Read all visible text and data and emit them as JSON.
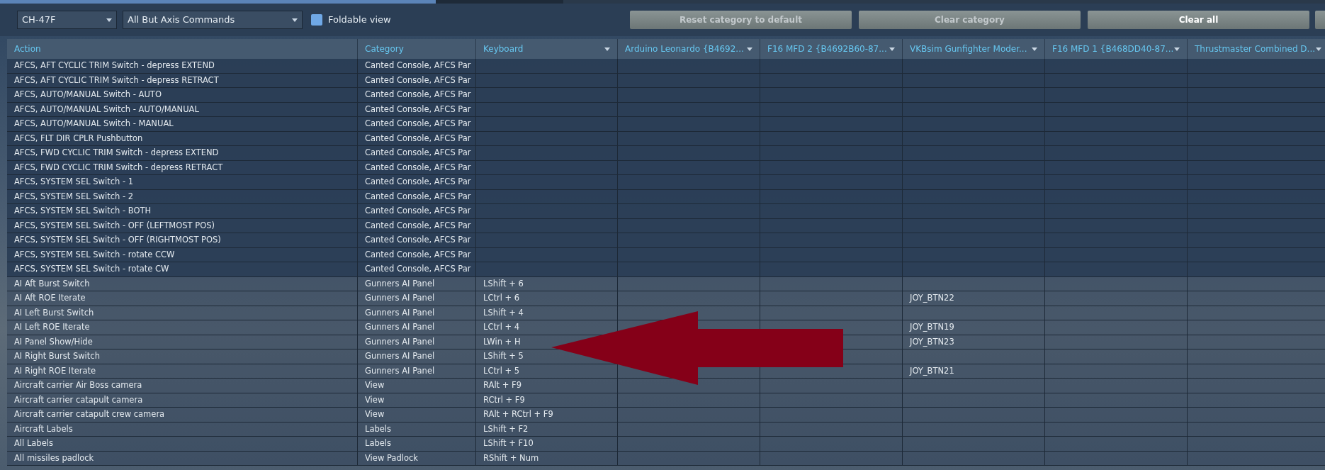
{
  "toolbar": {
    "aircraft_select": {
      "value": "CH-47F"
    },
    "filter_select": {
      "value": "All But Axis Commands"
    },
    "foldable_view": {
      "label": "Foldable view",
      "checked": true
    },
    "buttons": [
      {
        "label": "Reset category to default",
        "disabled": true
      },
      {
        "label": "Clear category",
        "disabled": true
      },
      {
        "label": "Clear all",
        "disabled": false
      }
    ]
  },
  "table": {
    "columns": [
      {
        "label": "Action",
        "dropdown": false
      },
      {
        "label": "Category",
        "dropdown": false
      },
      {
        "label": "Keyboard",
        "dropdown": true
      },
      {
        "label": "Arduino Leonardo {B4692...",
        "dropdown": true
      },
      {
        "label": "F16 MFD 2 {B4692B60-87...",
        "dropdown": true
      },
      {
        "label": "VKBsim Gunfighter Moder...",
        "dropdown": true
      },
      {
        "label": "F16 MFD 1 {B468DD40-87...",
        "dropdown": true
      },
      {
        "label": "Thrustmaster Combined D...",
        "dropdown": true
      }
    ],
    "rows": [
      {
        "action": "AFCS, AFT CYCLIC TRIM Switch - depress EXTEND",
        "category": "Canted Console, AFCS Par"
      },
      {
        "action": "AFCS, AFT CYCLIC TRIM Switch - depress RETRACT",
        "category": "Canted Console, AFCS Par"
      },
      {
        "action": "AFCS, AUTO/MANUAL Switch - AUTO",
        "category": "Canted Console, AFCS Par"
      },
      {
        "action": "AFCS, AUTO/MANUAL Switch - AUTO/MANUAL",
        "category": "Canted Console, AFCS Par"
      },
      {
        "action": "AFCS, AUTO/MANUAL Switch - MANUAL",
        "category": "Canted Console, AFCS Par"
      },
      {
        "action": "AFCS, FLT DIR CPLR Pushbutton",
        "category": "Canted Console, AFCS Par"
      },
      {
        "action": "AFCS, FWD CYCLIC TRIM Switch - depress EXTEND",
        "category": "Canted Console, AFCS Par"
      },
      {
        "action": "AFCS, FWD CYCLIC TRIM Switch - depress RETRACT",
        "category": "Canted Console, AFCS Par"
      },
      {
        "action": "AFCS, SYSTEM SEL Switch - 1",
        "category": "Canted Console, AFCS Par"
      },
      {
        "action": "AFCS, SYSTEM SEL Switch - 2",
        "category": "Canted Console, AFCS Par"
      },
      {
        "action": "AFCS, SYSTEM SEL Switch - BOTH",
        "category": "Canted Console, AFCS Par"
      },
      {
        "action": "AFCS, SYSTEM SEL Switch - OFF (LEFTMOST POS)",
        "category": "Canted Console, AFCS Par"
      },
      {
        "action": "AFCS, SYSTEM SEL Switch - OFF (RIGHTMOST POS)",
        "category": "Canted Console, AFCS Par"
      },
      {
        "action": "AFCS, SYSTEM SEL Switch - rotate CCW",
        "category": "Canted Console, AFCS Par"
      },
      {
        "action": "AFCS, SYSTEM SEL Switch - rotate CW",
        "category": "Canted Console, AFCS Par"
      },
      {
        "action": "AI Aft Burst Switch",
        "category": "Gunners AI Panel",
        "keyboard": "LShift + 6"
      },
      {
        "action": "AI Aft ROE Iterate",
        "category": "Gunners AI Panel",
        "keyboard": "LCtrl + 6",
        "vkbsim": "JOY_BTN22"
      },
      {
        "action": "AI Left Burst Switch",
        "category": "Gunners AI Panel",
        "keyboard": "LShift + 4"
      },
      {
        "action": "AI Left ROE Iterate",
        "category": "Gunners AI Panel",
        "keyboard": "LCtrl + 4",
        "vkbsim": "JOY_BTN19"
      },
      {
        "action": "AI Panel Show/Hide",
        "category": "Gunners AI Panel",
        "keyboard": "LWin + H",
        "vkbsim": "JOY_BTN23"
      },
      {
        "action": "AI Right Burst Switch",
        "category": "Gunners AI Panel",
        "keyboard": "LShift + 5"
      },
      {
        "action": "AI Right ROE Iterate",
        "category": "Gunners AI Panel",
        "keyboard": "LCtrl + 5",
        "vkbsim": "JOY_BTN21"
      },
      {
        "action": "Aircraft carrier Air Boss camera",
        "category": "View",
        "keyboard": "RAlt + F9"
      },
      {
        "action": "Aircraft carrier catapult camera",
        "category": "View",
        "keyboard": "RCtrl + F9"
      },
      {
        "action": "Aircraft carrier catapult crew camera",
        "category": "View",
        "keyboard": "RAlt + RCtrl + F9"
      },
      {
        "action": "Aircraft Labels",
        "category": "Labels",
        "keyboard": "LShift + F2"
      },
      {
        "action": "All Labels",
        "category": "Labels",
        "keyboard": "LShift + F10"
      },
      {
        "action": "All missiles padlock",
        "category": "View Padlock",
        "keyboard": "RShift + Num"
      }
    ]
  }
}
